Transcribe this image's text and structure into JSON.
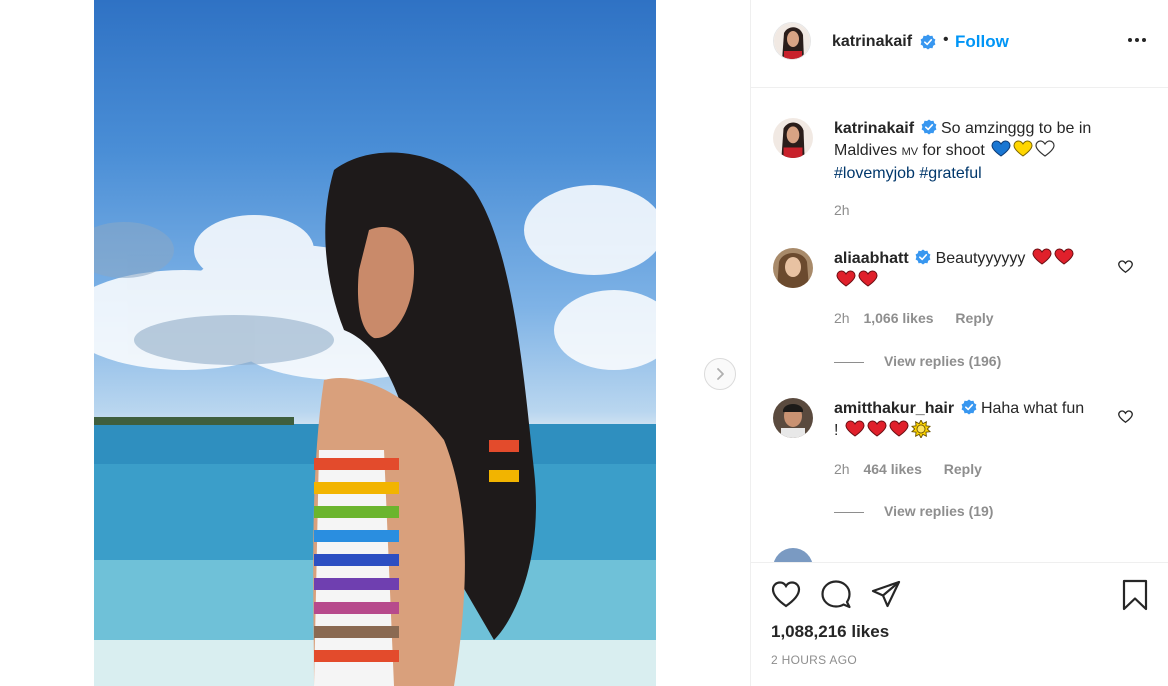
{
  "post": {
    "author": "katrinakaif",
    "follow_label": "Follow",
    "separator": "•"
  },
  "caption": {
    "username": "katrinakaif",
    "text": "So amzinggg to be in Maldives",
    "flag_text": "MV",
    "text_after": "for shoot",
    "hashtags": [
      "#lovemyjob",
      "#grateful"
    ],
    "time": "2h"
  },
  "comments": [
    {
      "username": "aliaabhatt",
      "text": "Beautyyyyyy",
      "time": "2h",
      "likes": "1,066 likes",
      "reply_label": "Reply",
      "view_replies": "View replies (196)"
    },
    {
      "username": "amitthakur_hair",
      "text": "Haha what fun",
      "text_tail": "!",
      "time": "2h",
      "likes": "464 likes",
      "reply_label": "Reply",
      "view_replies": "View replies (19)"
    }
  ],
  "footer": {
    "likes": "1,088,216 likes",
    "time_ago": "2 HOURS AGO"
  },
  "icons": {
    "verified": "verified-badge-icon",
    "more": "more-options-icon",
    "like": "heart-icon",
    "comment": "comment-icon",
    "share": "share-icon",
    "save": "bookmark-icon",
    "next": "chevron-right-icon"
  },
  "colors": {
    "link": "#0095f6",
    "hashtag": "#00376b",
    "muted": "#8e8e8e",
    "verified": "#3897f0"
  }
}
